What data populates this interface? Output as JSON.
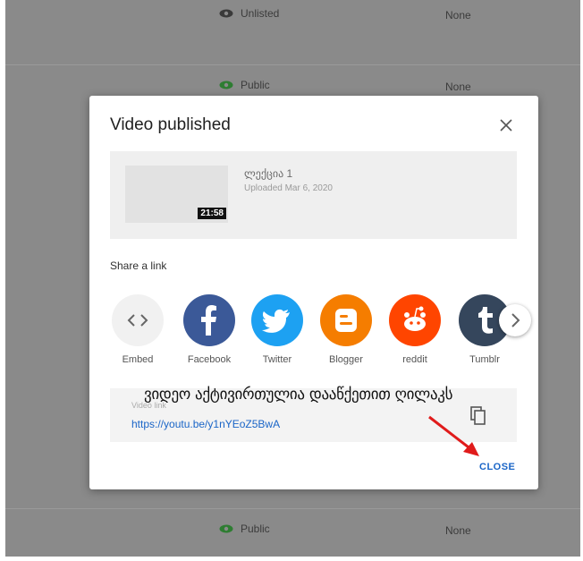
{
  "background_rows": [
    {
      "visibility": "Unlisted",
      "restrictions": "None"
    },
    {
      "visibility": "Public",
      "restrictions": "None"
    },
    {
      "visibility": "Public",
      "restrictions": "None"
    }
  ],
  "dialog": {
    "title": "Video published",
    "video": {
      "title": "ლექცია 1",
      "uploaded": "Uploaded Mar 6, 2020",
      "duration": "21:58"
    },
    "share_label": "Share a link",
    "share_targets": [
      {
        "label": "Embed",
        "icon": "embed-code-icon",
        "color": "#f1f1f1"
      },
      {
        "label": "Facebook",
        "icon": "facebook-icon",
        "color": "#3b5998"
      },
      {
        "label": "Twitter",
        "icon": "twitter-icon",
        "color": "#1da1f2"
      },
      {
        "label": "Blogger",
        "icon": "blogger-icon",
        "color": "#f57d00"
      },
      {
        "label": "reddit",
        "icon": "reddit-icon",
        "color": "#ff4500"
      },
      {
        "label": "Tumblr",
        "icon": "tumblr-icon",
        "color": "#35465c"
      }
    ],
    "link": {
      "label": "Video link",
      "url": "https://youtu.be/y1nYEoZ5BwA",
      "overlay_note": "ვიდეო აქტივირთულია დააწქეთით ღილაკს"
    },
    "close_label": "CLOSE"
  },
  "colors": {
    "accent": "#1a65c7",
    "arrow": "#e01b1b",
    "public_icon": "#2e7d32"
  }
}
